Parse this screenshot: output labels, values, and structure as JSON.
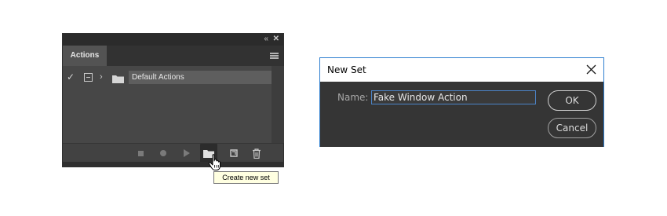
{
  "actions_panel": {
    "collapse_glyph": "«",
    "close_glyph": "✕",
    "tab_label": "Actions",
    "menu_icon": "panel-menu-icon",
    "rows": [
      {
        "checked": true,
        "check_glyph": "✓",
        "expand_glyph": "›",
        "name": "Default Actions"
      }
    ],
    "footer_icons": [
      "stop-icon",
      "record-icon",
      "play-icon",
      "create-new-set-icon",
      "create-new-action-icon",
      "delete-icon"
    ],
    "tooltip": "Create new set"
  },
  "new_set_dialog": {
    "title": "New Set",
    "name_label": "Name:",
    "name_value": "Fake Window Action",
    "ok_label": "OK",
    "cancel_label": "Cancel"
  },
  "colors": {
    "panel_bg": "#424242",
    "dialog_bg": "#353535",
    "dialog_border": "#2f7fd0",
    "input_border": "#4c84c8",
    "tooltip_bg": "#ffffe1"
  }
}
